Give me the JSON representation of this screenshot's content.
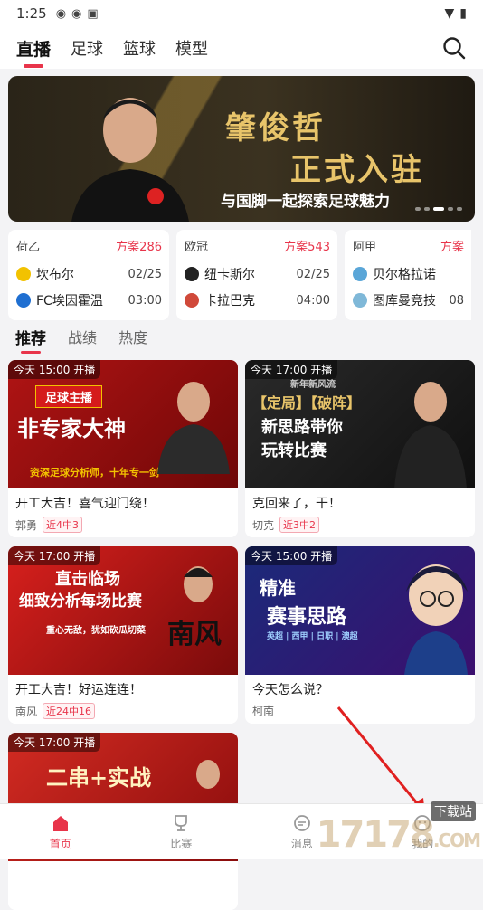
{
  "status_bar": {
    "time": "1:25",
    "icons": [
      "vpn-icon",
      "sync-icon",
      "font-icon"
    ],
    "right_icons": [
      "wifi-icon",
      "battery-icon"
    ]
  },
  "top_tabs": [
    {
      "label": "直播",
      "active": true
    },
    {
      "label": "足球",
      "active": false
    },
    {
      "label": "篮球",
      "active": false
    },
    {
      "label": "模型",
      "active": false
    }
  ],
  "banner": {
    "title_line1": "肇俊哲",
    "title_line2": "正式入驻",
    "subtitle": "与国脚一起探索足球魅力",
    "dots": 5,
    "active_dot": 3
  },
  "matches": [
    {
      "league": "荷乙",
      "plan": "方案286",
      "teams": [
        {
          "name": "坎布尔",
          "time": "02/25",
          "color": "#f2c200"
        },
        {
          "name": "FC埃因霍温",
          "time": "03:00",
          "color": "#1f6fd1"
        }
      ]
    },
    {
      "league": "欧冠",
      "plan": "方案543",
      "teams": [
        {
          "name": "纽卡斯尔",
          "time": "02/25",
          "color": "#222222"
        },
        {
          "name": "卡拉巴克",
          "time": "04:00",
          "color": "#d0493a"
        }
      ]
    },
    {
      "league": "阿甲",
      "plan": "方案",
      "teams": [
        {
          "name": "贝尔格拉诺",
          "time": "",
          "color": "#5aa6d8"
        },
        {
          "name": "图库曼竞技",
          "time": "08",
          "color": "#7fb8d8"
        }
      ]
    }
  ],
  "sub_tabs": [
    {
      "label": "推荐",
      "active": true
    },
    {
      "label": "战绩",
      "active": false
    },
    {
      "label": "热度",
      "active": false
    }
  ],
  "cards": [
    {
      "tag": "今天 15:00 开播",
      "title": "开工大吉！喜气迎门绕！",
      "author": "郭勇",
      "badge": "近4中3",
      "theme": "t1",
      "art": [
        "足球主播",
        "非专家大神",
        "资深足球分析师，十年专一剑"
      ]
    },
    {
      "tag": "今天 17:00 开播",
      "title": "克回来了，干！",
      "author": "切克",
      "badge": "近3中2",
      "theme": "t2",
      "art": [
        "新年新风流",
        "【定局】【破阵】",
        "新思路带你",
        "玩转比赛"
      ]
    },
    {
      "tag": "今天 17:00 开播",
      "title": "开工大吉！好运连连！",
      "author": "南风",
      "badge": "近24中16",
      "theme": "t3",
      "art": [
        "直击临场",
        "细致分析每场比赛",
        "重心无敌，犹如砍瓜切菜",
        "南风"
      ]
    },
    {
      "tag": "今天 15:00 开播",
      "title": "今天怎么说？",
      "author": "柯南",
      "badge": "",
      "theme": "t4",
      "art": [
        "精准",
        "赛事思路",
        "英超 | 西甲 | 日职 | 澳超"
      ]
    },
    {
      "tag": "今天 17:00 开播",
      "title": "",
      "author": "",
      "badge": "",
      "theme": "t5",
      "art": [
        "二串+实战"
      ]
    }
  ],
  "bottom_nav": [
    {
      "label": "首页",
      "icon": "home-icon",
      "active": true
    },
    {
      "label": "比赛",
      "icon": "trophy-icon",
      "active": false
    },
    {
      "label": "消息",
      "icon": "message-icon",
      "active": false
    },
    {
      "label": "我的",
      "icon": "profile-icon",
      "active": false
    }
  ],
  "watermark": {
    "text": "17178",
    "sub": "下载站",
    "tail": ".COM"
  },
  "colors": {
    "accent": "#e8344a",
    "gold": "#e8c46a"
  }
}
